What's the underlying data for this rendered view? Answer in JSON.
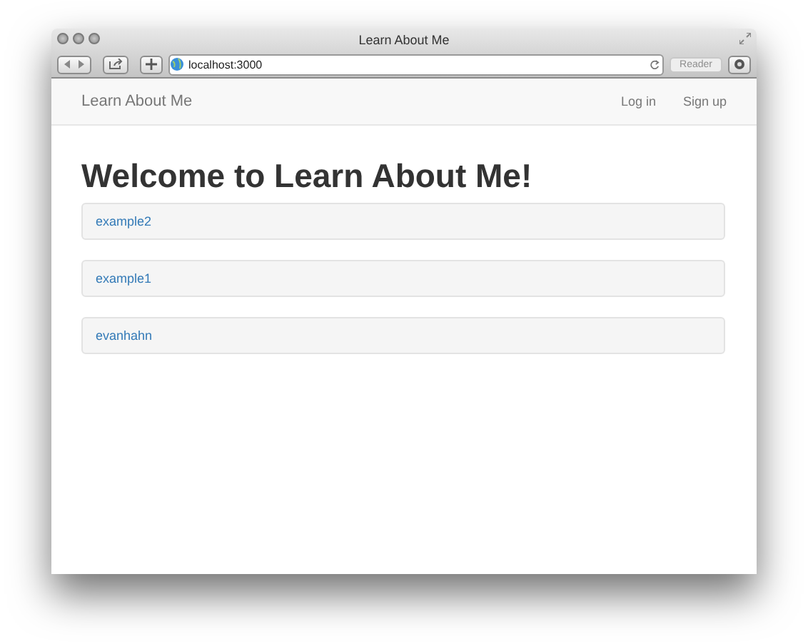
{
  "window": {
    "title": "Learn About Me"
  },
  "toolbar": {
    "address": "localhost:3000",
    "reader_button": {
      "label": "Reader",
      "disabled": true
    }
  },
  "navbar": {
    "brand": "Learn About Me",
    "links": [
      "Log in",
      "Sign up"
    ]
  },
  "heading": "Welcome to Learn About Me!",
  "users": [
    {
      "name": "example2"
    },
    {
      "name": "example1"
    },
    {
      "name": "evanhahn"
    }
  ]
}
